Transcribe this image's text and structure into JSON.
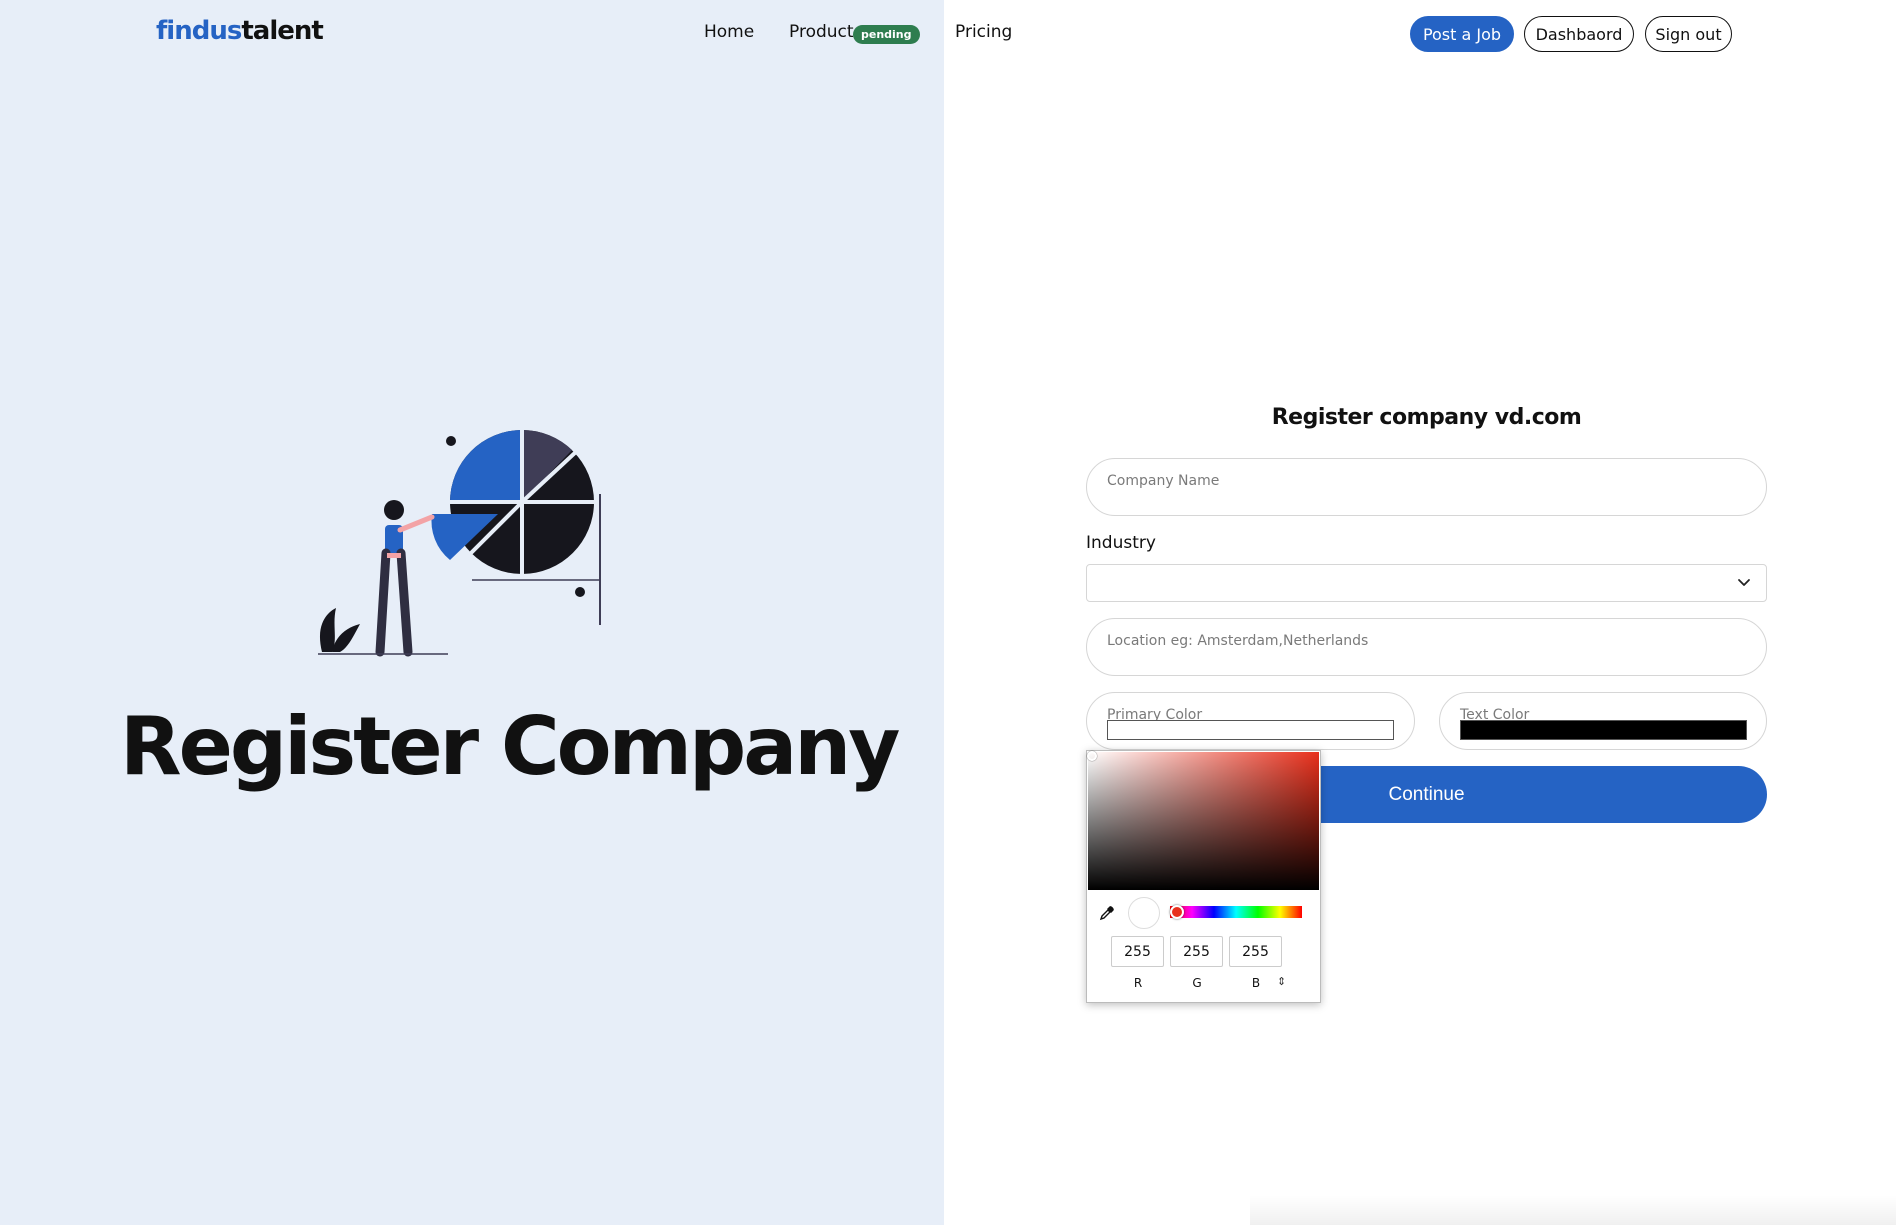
{
  "navbar": {
    "logo_part1": "findus",
    "logo_part2": "talent",
    "links": {
      "home": "Home",
      "product": "Product",
      "product_badge": "pending",
      "pricing": "Pricing"
    },
    "buttons": {
      "post_job": "Post a Job",
      "dashboard": "Dashbaord",
      "sign_out": "Sign out"
    }
  },
  "hero": {
    "title": "Register Company"
  },
  "form": {
    "title": "Register company vd.com",
    "company_name_placeholder": "Company Name",
    "industry_label": "Industry",
    "industry_value": "",
    "location_placeholder": "Location eg: Amsterdam,Netherlands",
    "primary_color_label": "Primary Color",
    "primary_color_value": "#ffffff",
    "text_color_label": "Text Color",
    "text_color_value": "#000000",
    "continue_label": "Continue"
  },
  "color_picker": {
    "r": "255",
    "g": "255",
    "b": "255",
    "label_r": "R",
    "label_g": "G",
    "label_b": "B",
    "mode_toggle": "⇕",
    "hue_color": "#e8301c"
  },
  "colors": {
    "brand": "#2563c4",
    "left_bg": "#e7eef8",
    "badge": "#2e7d4f"
  },
  "icons": {
    "select": "chevron-down-icon",
    "eyedropper": "eyedropper-icon"
  }
}
